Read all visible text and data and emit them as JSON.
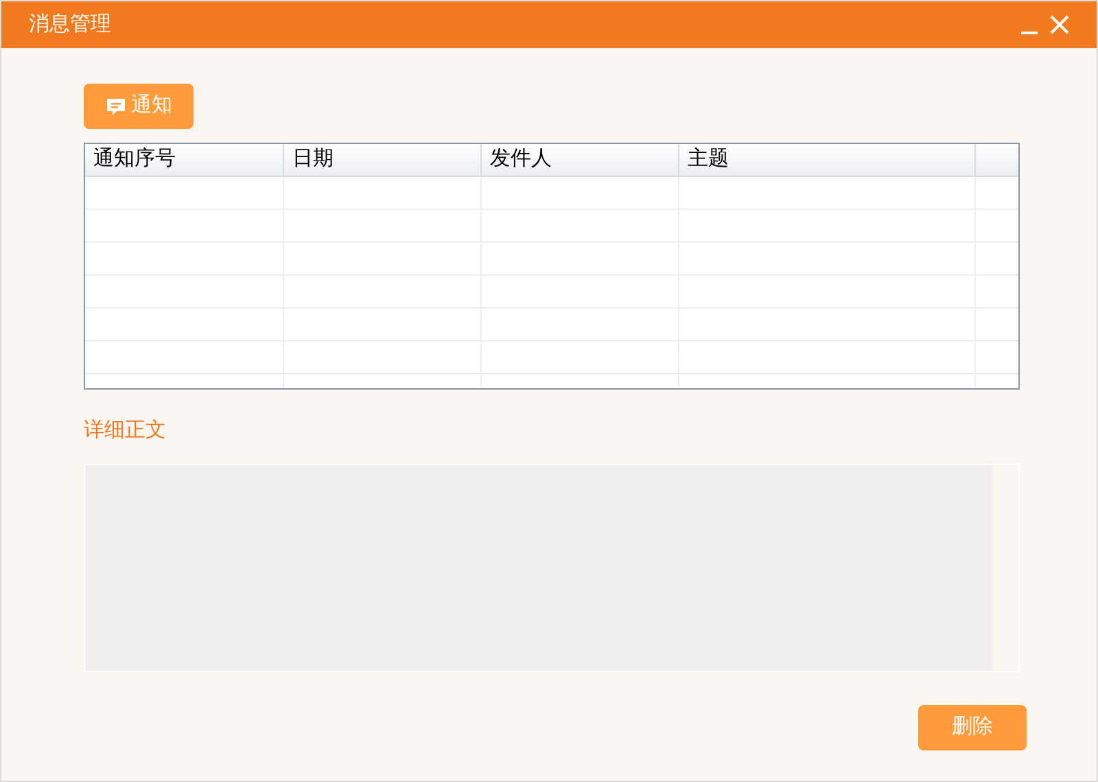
{
  "window": {
    "title": "消息管理"
  },
  "toolbar": {
    "button": "通知"
  },
  "table": {
    "columns": [
      "通知序号",
      "日期",
      "发件人",
      "主题"
    ]
  },
  "detail": {
    "label": "详细正文"
  },
  "buttons": [
    "删除"
  ]
}
